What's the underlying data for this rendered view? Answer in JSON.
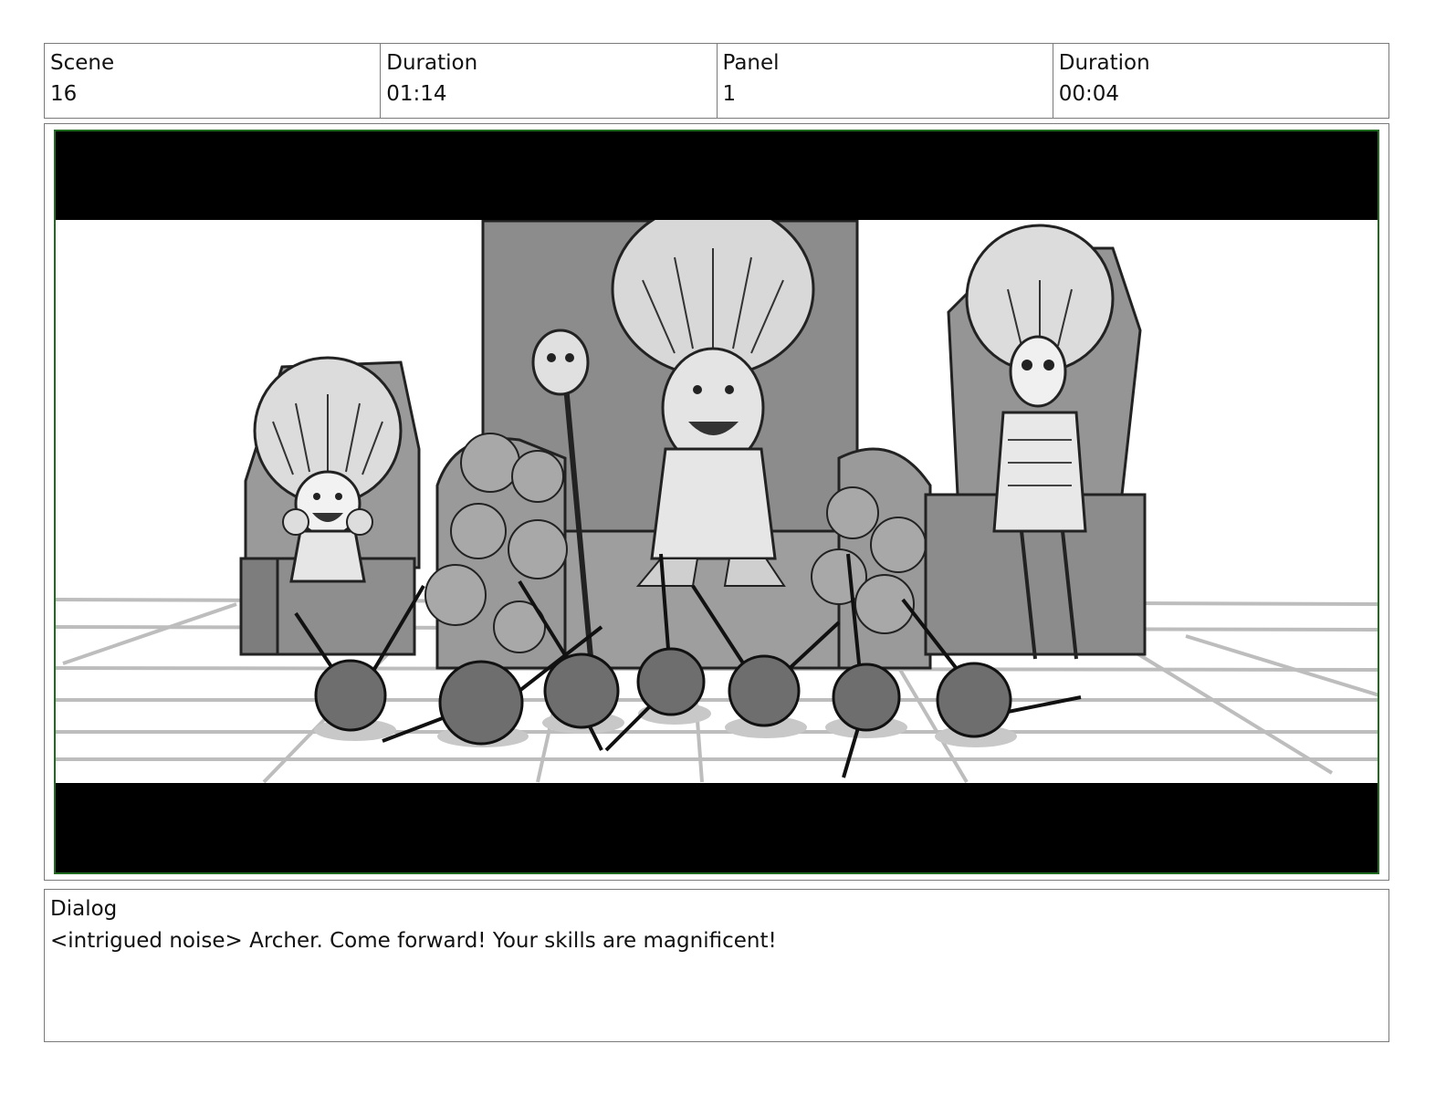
{
  "header": {
    "scene_label": "Scene",
    "scene_value": "16",
    "scene_duration_label": "Duration",
    "scene_duration_value": "01:14",
    "panel_label": "Panel",
    "panel_value": "1",
    "panel_duration_label": "Duration",
    "panel_duration_value": "00:04"
  },
  "panel": {
    "image_icon": "storyboard-sketch-icon",
    "frame_color": "#1f6b1f",
    "letterbox_color": "#000000"
  },
  "dialog": {
    "label": "Dialog",
    "text": "<intrigued noise> Archer. Come forward! Your skills are magnificent!"
  }
}
